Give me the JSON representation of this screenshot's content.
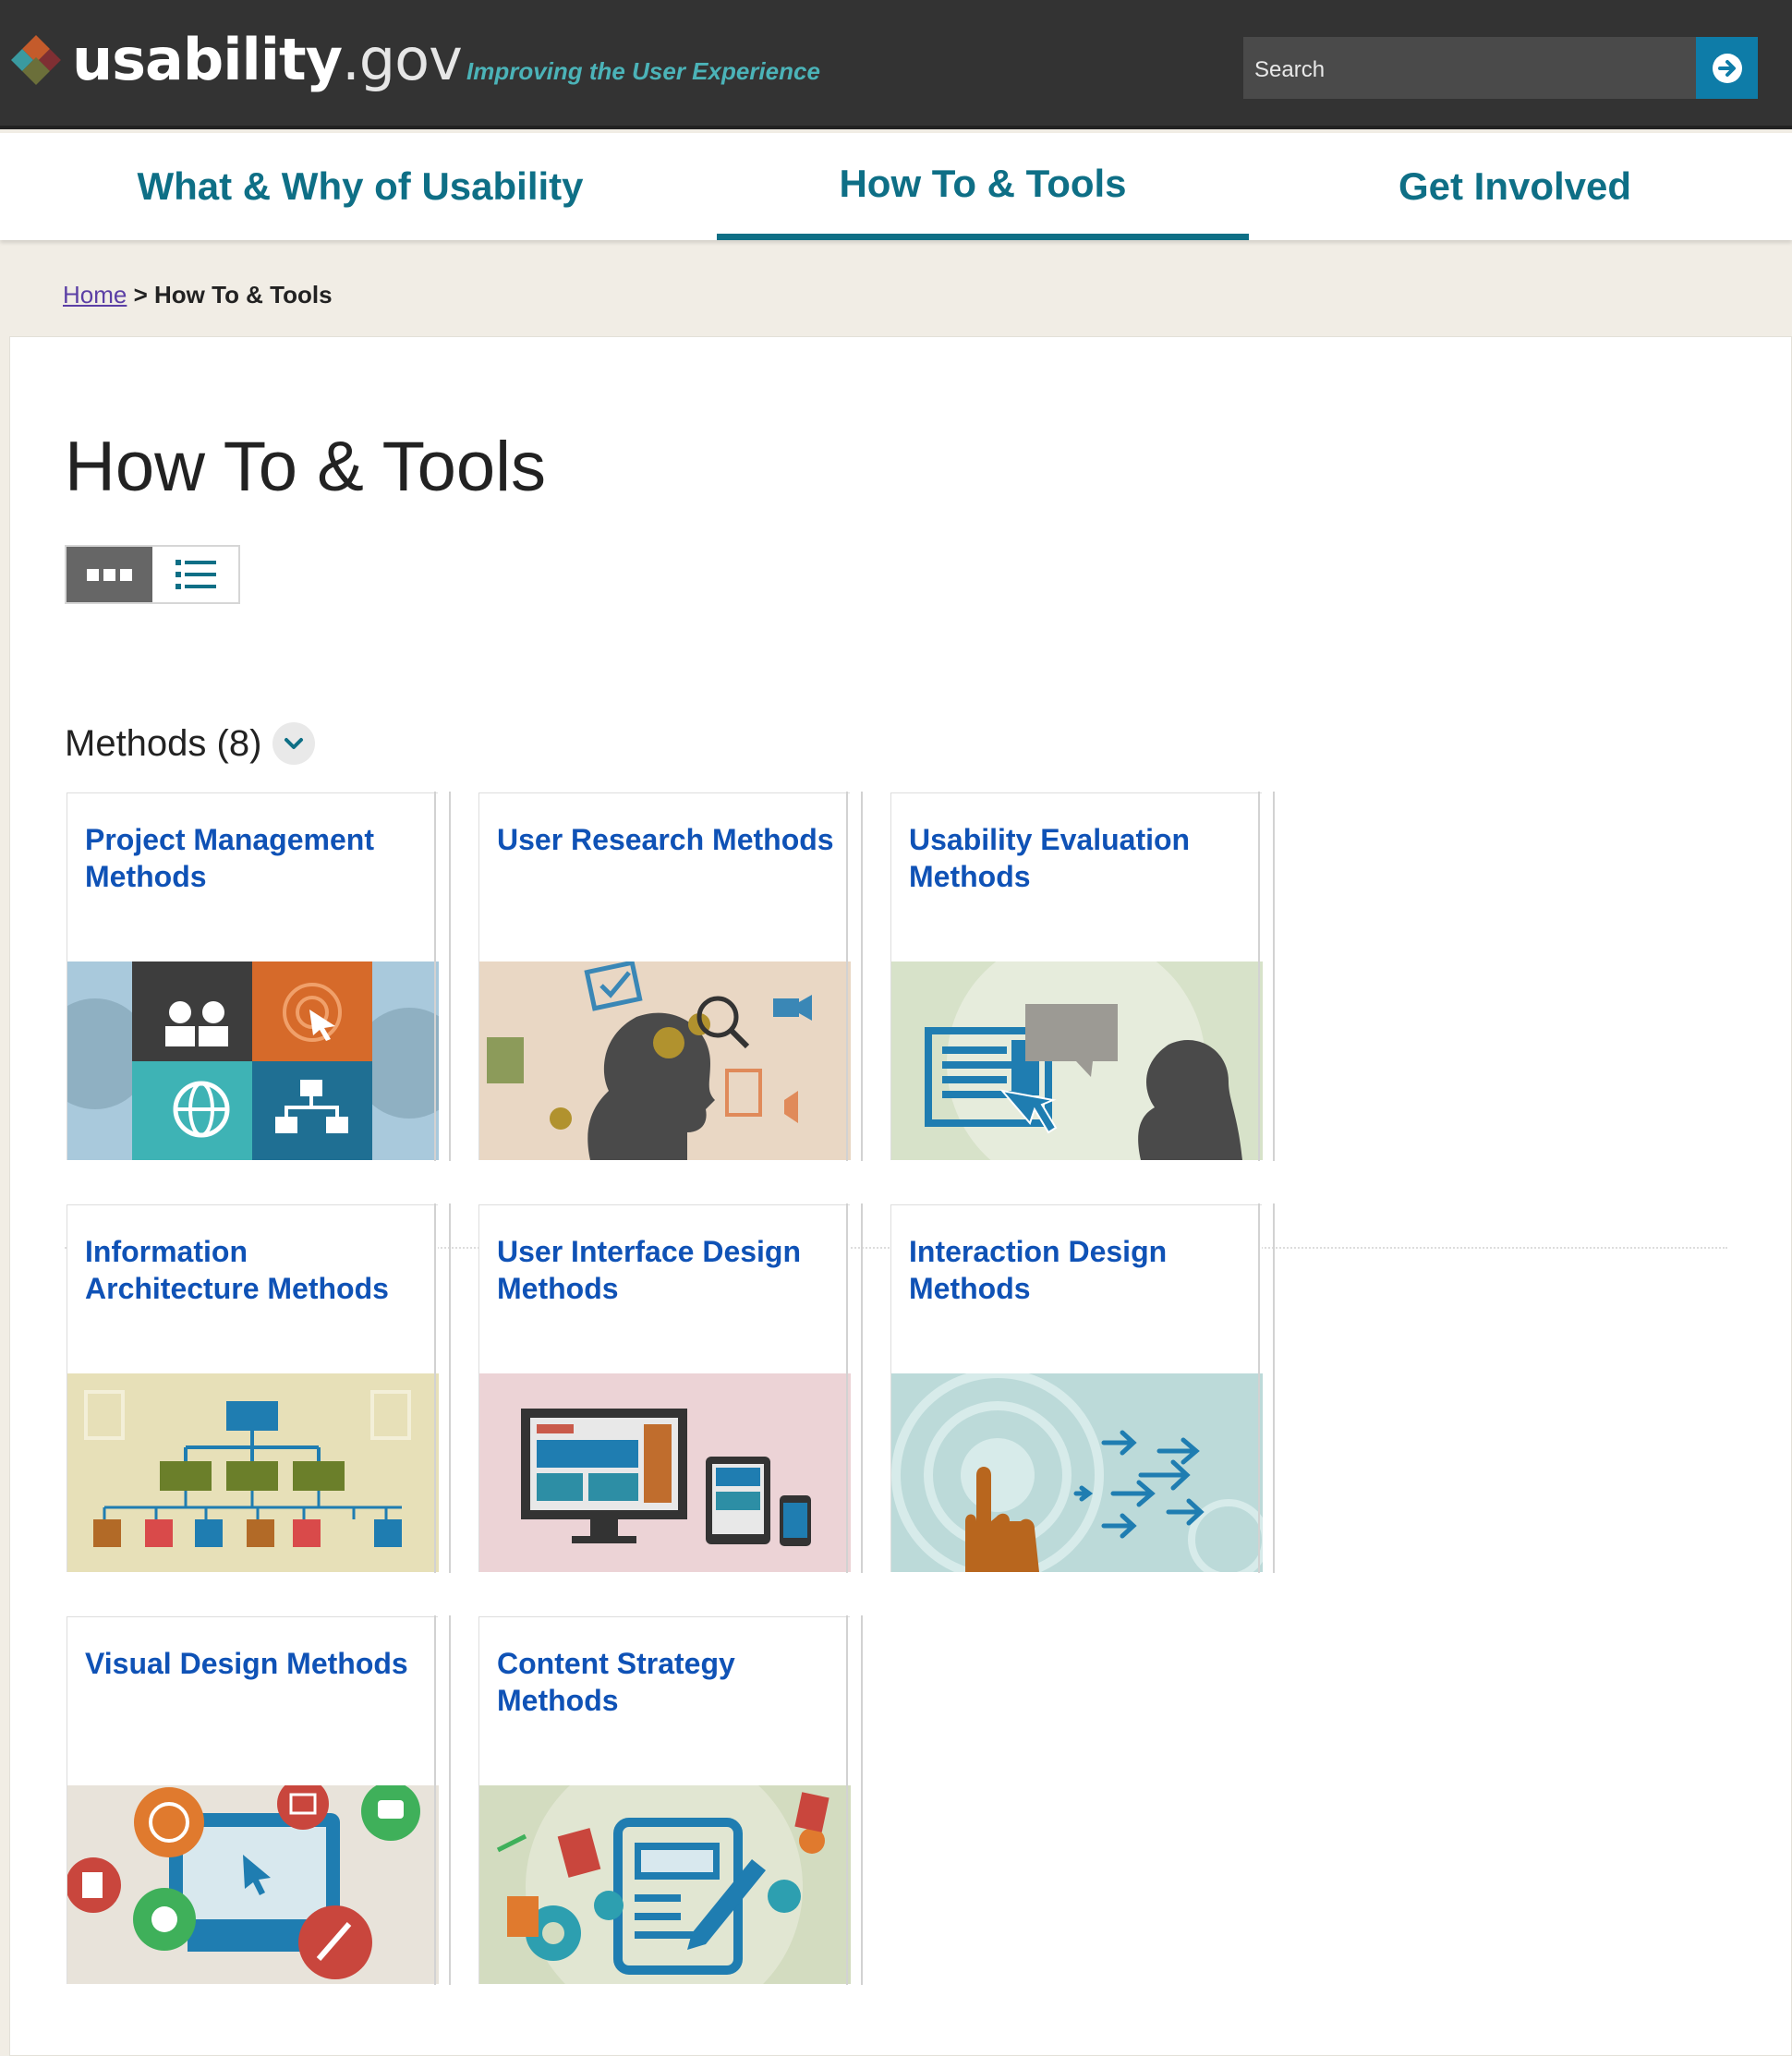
{
  "header": {
    "logo_bold": "usability",
    "logo_tld": ".gov",
    "tagline": "Improving the User Experience",
    "search_placeholder": "Search"
  },
  "nav": {
    "items": [
      {
        "label": "What & Why of Usability"
      },
      {
        "label": "How To & Tools"
      },
      {
        "label": "Get Involved"
      }
    ],
    "active": "How To & Tools"
  },
  "breadcrumb": {
    "home": "Home",
    "separator": ">",
    "current": "How To & Tools"
  },
  "page": {
    "title": "How To & Tools",
    "section_title": "Methods (8)"
  },
  "cards": [
    {
      "title": "Project Management Methods"
    },
    {
      "title": "User Research Methods"
    },
    {
      "title": "Usability Evaluation Methods"
    },
    {
      "title": "Information Architecture Methods"
    },
    {
      "title": "User Interface Design Methods"
    },
    {
      "title": "Interaction Design Methods"
    },
    {
      "title": "Visual Design Methods"
    },
    {
      "title": "Content Strategy Methods"
    }
  ],
  "colors": {
    "header_bg": "#333333",
    "nav_text": "#0e6f86",
    "link": "#0f52b6",
    "tagline": "#4bb3b8",
    "search_button": "#0e7ca8"
  }
}
